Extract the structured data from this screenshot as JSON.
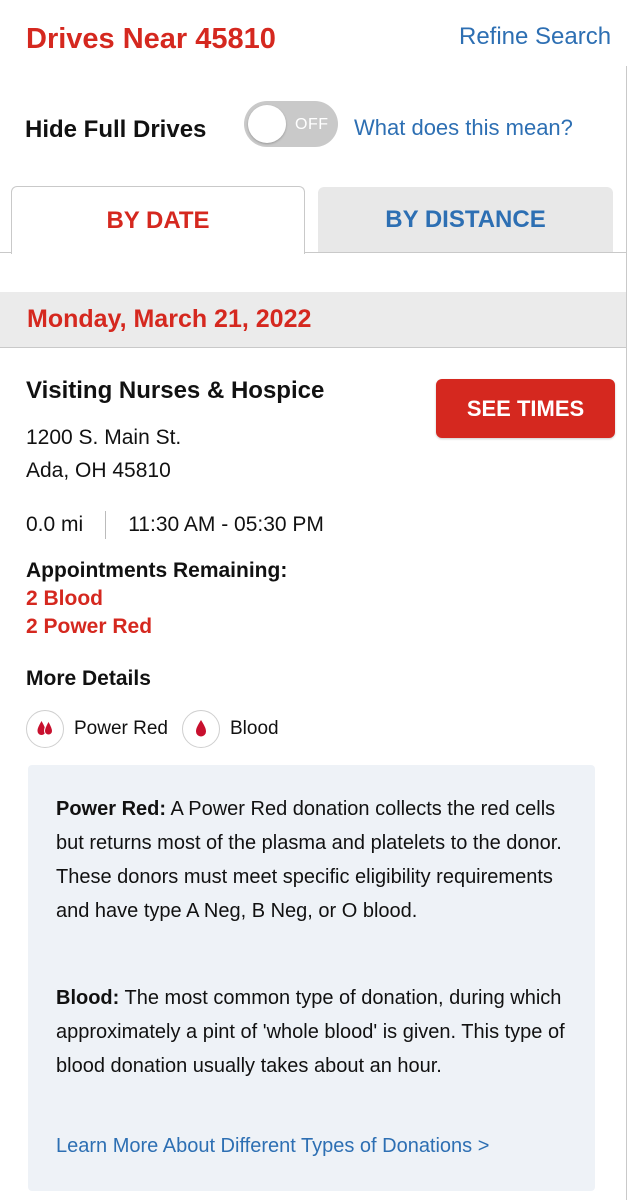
{
  "header": {
    "title": "Drives Near 45810",
    "refine_label": "Refine Search"
  },
  "filter": {
    "hide_full_label": "Hide Full Drives",
    "toggle_state": "OFF",
    "help_link": "What does this mean?"
  },
  "tabs": [
    {
      "label": "BY DATE",
      "active": true
    },
    {
      "label": "BY DISTANCE",
      "active": false
    }
  ],
  "date_header": "Monday, March 21, 2022",
  "drive": {
    "name": "Visiting Nurses & Hospice",
    "button_label": "SEE TIMES",
    "address_line1": "1200 S. Main St.",
    "address_line2": "Ada, OH 45810",
    "distance": "0.0 mi",
    "hours": "11:30 AM - 05:30 PM",
    "appointments_label": "Appointments Remaining:",
    "appointments": [
      "2 Blood",
      "2 Power Red"
    ],
    "more_details_label": "More Details",
    "donation_types": [
      {
        "label": "Power Red",
        "icon": "power-red-drops-icon"
      },
      {
        "label": "Blood",
        "icon": "blood-drop-icon"
      }
    ]
  },
  "info": {
    "power_red_term": "Power Red:",
    "power_red_text": " A Power Red donation collects the red cells but returns most of the plasma and platelets to the donor. These donors must meet specific eligibility requirements and have type A Neg, B Neg, or O blood.",
    "blood_term": "Blood:",
    "blood_text": " The most common type of donation, during which approximately a pint of 'whole blood' is given. This type of blood donation usually takes about an hour.",
    "learn_more_link": "Learn More About Different Types of Donations >"
  },
  "colors": {
    "brand_red": "#d5281f",
    "link_blue": "#2d6fb3",
    "info_bg": "#eef2f7"
  }
}
